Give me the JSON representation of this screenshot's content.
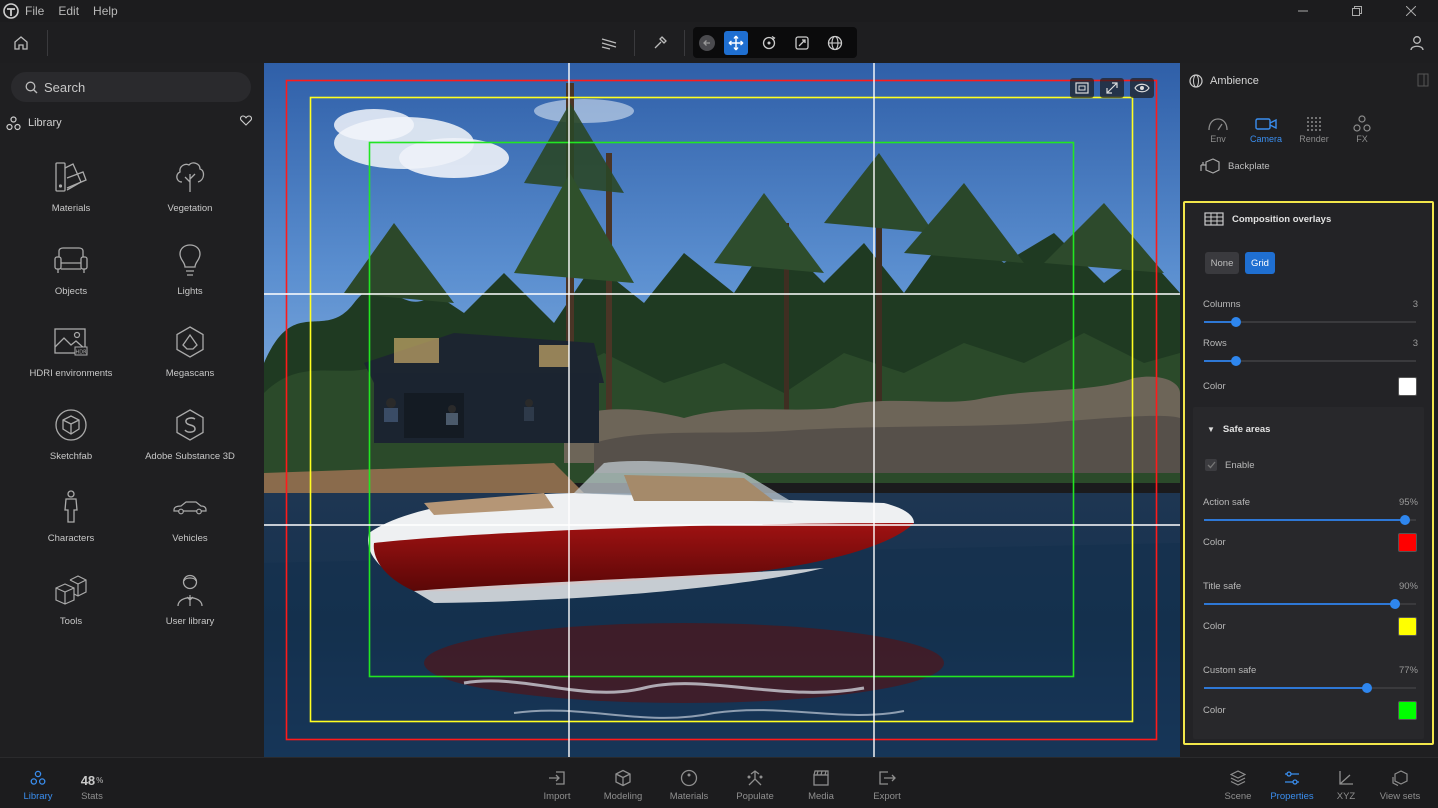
{
  "menubar": {
    "items": [
      "File",
      "Edit",
      "Help"
    ]
  },
  "left_panel": {
    "search_placeholder": "Search",
    "library_title": "Library",
    "items": [
      {
        "label": "Materials",
        "icon": "materials-icon"
      },
      {
        "label": "Vegetation",
        "icon": "tree-icon"
      },
      {
        "label": "Objects",
        "icon": "sofa-icon"
      },
      {
        "label": "Lights",
        "icon": "bulb-icon"
      },
      {
        "label": "HDRI environments",
        "icon": "hdri-icon"
      },
      {
        "label": "Megascans",
        "icon": "megascans-icon"
      },
      {
        "label": "Sketchfab",
        "icon": "sketchfab-icon"
      },
      {
        "label": "Adobe Substance 3D",
        "icon": "substance-icon"
      },
      {
        "label": "Characters",
        "icon": "person-icon"
      },
      {
        "label": "Vehicles",
        "icon": "car-icon"
      },
      {
        "label": "Tools",
        "icon": "cubes-icon"
      },
      {
        "label": "User library",
        "icon": "user-icon"
      }
    ]
  },
  "right_panel": {
    "title": "Ambience",
    "tabs": [
      {
        "label": "Env",
        "active": false
      },
      {
        "label": "Camera",
        "active": true
      },
      {
        "label": "Render",
        "active": false
      },
      {
        "label": "FX",
        "active": false
      }
    ],
    "backplate_label": "Backplate",
    "composition": {
      "title": "Composition overlays",
      "mode_options": [
        "None",
        "Grid"
      ],
      "mode_selected": "Grid",
      "columns_label": "Columns",
      "columns_value": "3",
      "columns_fraction": 0.15,
      "rows_label": "Rows",
      "rows_value": "3",
      "rows_fraction": 0.15,
      "color_label": "Color",
      "grid_color": "#ffffff",
      "safe_areas": {
        "title": "Safe areas",
        "enable_label": "Enable",
        "enabled": true,
        "action_label": "Action safe",
        "action_value": "95%",
        "action_fraction": 0.95,
        "action_color_label": "Color",
        "action_color": "#ff0000",
        "title_label": "Title safe",
        "title_value": "90%",
        "title_fraction": 0.9,
        "title_color_label": "Color",
        "title_color": "#ffff00",
        "custom_label": "Custom safe",
        "custom_value": "77%",
        "custom_fraction": 0.77,
        "custom_color_label": "Color",
        "custom_color": "#00ff00"
      }
    }
  },
  "bottombar": {
    "left": [
      {
        "label": "Library",
        "active": true
      },
      {
        "label": "Stats",
        "active": false,
        "value": "48",
        "unit": "%"
      }
    ],
    "center": [
      "Import",
      "Modeling",
      "Materials",
      "Populate",
      "Media",
      "Export"
    ],
    "right": [
      {
        "label": "Scene",
        "active": false
      },
      {
        "label": "Properties",
        "active": true
      },
      {
        "label": "XYZ",
        "active": false
      },
      {
        "label": "View sets",
        "active": false
      }
    ]
  },
  "colors": {
    "accent": "#1f6fd1",
    "highlight_border": "#f2e64a"
  }
}
